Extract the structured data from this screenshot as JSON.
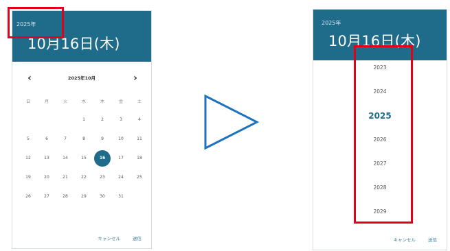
{
  "left": {
    "header_year": "2025年",
    "header_date": "10月16日(木)",
    "month_label": "2025年10月",
    "prev_icon": "‹",
    "next_icon": "›",
    "weekdays": [
      "日",
      "月",
      "火",
      "水",
      "木",
      "金",
      "土"
    ],
    "weeks": [
      [
        "",
        "",
        "",
        "1",
        "2",
        "3",
        "4"
      ],
      [
        "5",
        "6",
        "7",
        "8",
        "9",
        "10",
        "11"
      ],
      [
        "12",
        "13",
        "14",
        "15",
        "16",
        "17",
        "18"
      ],
      [
        "19",
        "20",
        "21",
        "22",
        "23",
        "24",
        "25"
      ],
      [
        "26",
        "27",
        "28",
        "29",
        "30",
        "31",
        ""
      ]
    ],
    "selected_day": "16",
    "cancel": "キャンセル",
    "send": "送信"
  },
  "right": {
    "header_year": "2025年",
    "header_date": "10月16日(木)",
    "years": [
      "2023",
      "2024",
      "2025",
      "2026",
      "2027",
      "2028",
      "2029"
    ],
    "current_year": "2025",
    "cancel": "キャンセル",
    "send": "送信"
  },
  "colors": {
    "header": "#1f6b8a",
    "highlight": "#e2001a",
    "arrow": "#1e73be"
  },
  "icons": {
    "transition": "triangle-right-outline-icon"
  }
}
